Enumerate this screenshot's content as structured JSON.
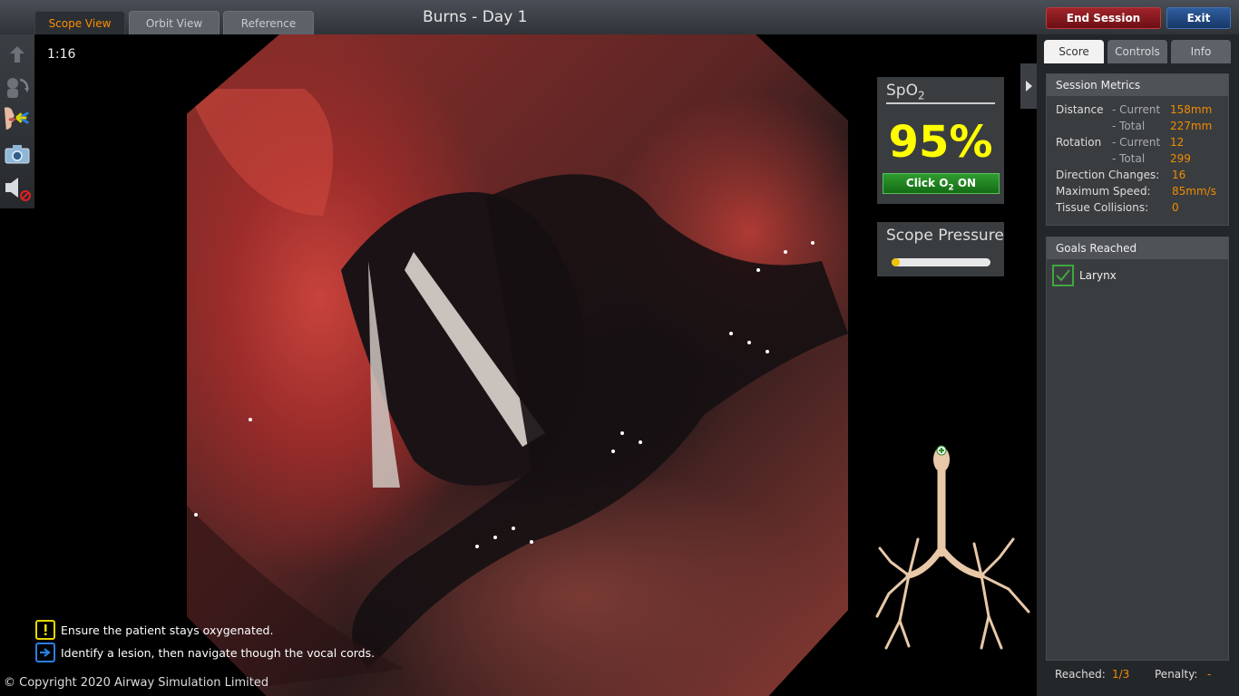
{
  "header": {
    "tabs": [
      {
        "label": "Scope View",
        "active": true
      },
      {
        "label": "Orbit View",
        "active": false
      },
      {
        "label": "Reference",
        "active": false
      }
    ],
    "title": "Burns - Day 1",
    "end_session_label": "End Session",
    "exit_label": "Exit"
  },
  "toolbar": {
    "icons": [
      "up-arrow-icon",
      "rotate-scope-icon",
      "oxygen-face-icon",
      "camera-icon",
      "sound-muted-icon"
    ]
  },
  "timer": "1:16",
  "spo2": {
    "title": "SpO",
    "title_sub": "2",
    "value": "95%",
    "button_prefix": "Click O",
    "button_sub": "2",
    "button_suffix": " ON",
    "value_color": "#ffff00"
  },
  "pressure": {
    "title": "Scope Pressure",
    "level": 0.08
  },
  "right_tabs": [
    {
      "label": "Score",
      "active": true
    },
    {
      "label": "Controls",
      "active": false
    },
    {
      "label": "Info",
      "active": false
    }
  ],
  "session_metrics": {
    "heading": "Session Metrics",
    "distance_label": "Distance",
    "current_label": "- Current",
    "total_label": "- Total",
    "distance_current": "158mm",
    "distance_total": "227mm",
    "rotation_label": "Rotation",
    "rotation_current": "12",
    "rotation_total": "299",
    "direction_changes_label": "Direction Changes:",
    "direction_changes": "16",
    "max_speed_label": "Maximum Speed:",
    "max_speed": "85mm/s",
    "tissue_collisions_label": "Tissue Collisions:",
    "tissue_collisions": "0"
  },
  "goals": {
    "heading": "Goals Reached",
    "items": [
      {
        "label": "Larynx",
        "checked": true
      }
    ]
  },
  "footer_stats": {
    "reached_label": "Reached:",
    "reached_value": "1/3",
    "penalty_label": "Penalty:",
    "penalty_value": "-"
  },
  "messages": [
    {
      "icon": "warning-icon",
      "text": "Ensure the patient stays oxygenated."
    },
    {
      "icon": "arrow-right-icon",
      "text": "Identify a lesion, then navigate though the vocal cords."
    }
  ],
  "copyright": "© Copyright 2020 Airway Simulation Limited",
  "colors": {
    "accent_orange": "#f08c00",
    "active_tab_text": "#ff8c00",
    "end_session_red": "#8b1a20",
    "exit_blue": "#234b86",
    "o2_green": "#1f841f"
  }
}
